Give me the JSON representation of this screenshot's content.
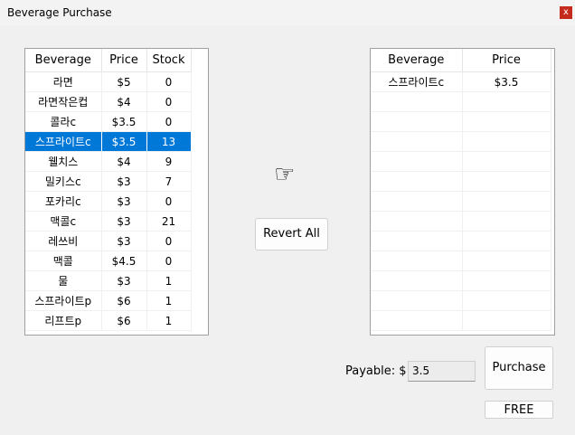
{
  "window": {
    "title": "Beverage Purchase",
    "close_label": "x"
  },
  "inventory": {
    "columns": [
      "Beverage",
      "Price",
      "Stock"
    ],
    "rows": [
      [
        "라면",
        "$5",
        "0"
      ],
      [
        "라면작은컵",
        "$4",
        "0"
      ],
      [
        "콜라c",
        "$3.5",
        "0"
      ],
      [
        "스프라이트c",
        "$3.5",
        "13"
      ],
      [
        "웰치스",
        "$4",
        "9"
      ],
      [
        "밀키스c",
        "$3",
        "7"
      ],
      [
        "포카리c",
        "$3",
        "0"
      ],
      [
        "맥콜c",
        "$3",
        "21"
      ],
      [
        "레쓰비",
        "$3",
        "0"
      ],
      [
        "맥콜",
        "$4.5",
        "0"
      ],
      [
        "물",
        "$3",
        "1"
      ],
      [
        "스프라이트p",
        "$6",
        "1"
      ],
      [
        "리프트p",
        "$6",
        "1"
      ]
    ],
    "selected_index": 3
  },
  "arrow_icon": "pointing-hand-right",
  "revert_label": "Revert All",
  "cart": {
    "columns": [
      "Beverage",
      "Price"
    ],
    "rows": [
      [
        "스프라이트c",
        "$3.5"
      ]
    ]
  },
  "payable": {
    "label": "Payable: $",
    "value": "3.5"
  },
  "purchase_label": "Purchase",
  "free_label": "FREE",
  "colors": {
    "selection": "#0078d7",
    "close": "#c42b1c"
  }
}
